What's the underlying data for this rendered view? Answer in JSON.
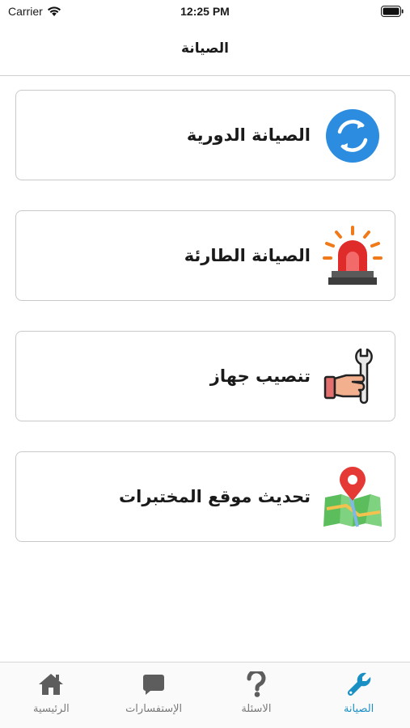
{
  "status_bar": {
    "carrier": "Carrier",
    "time": "12:25 PM"
  },
  "nav": {
    "title": "الصيانة"
  },
  "cards": [
    {
      "label": "الصيانة الدورية",
      "icon": "refresh-cycle-icon"
    },
    {
      "label": "الصيانة الطارئة",
      "icon": "siren-icon"
    },
    {
      "label": "تنصيب جهاز",
      "icon": "wrench-hand-icon"
    },
    {
      "label": "تحديث موقع المختبرات",
      "icon": "map-pin-icon"
    }
  ],
  "tabs": [
    {
      "label": "الرئيسية",
      "icon": "home-icon"
    },
    {
      "label": "الإستفسارات",
      "icon": "chat-icon"
    },
    {
      "label": "الاسئلة",
      "icon": "question-icon"
    },
    {
      "label": "الصيانة",
      "icon": "wrench-icon",
      "active": true
    }
  ],
  "colors": {
    "accent": "#1a8fc4",
    "inactive": "#5d5d5d",
    "cycle_blue": "#2b8ce0",
    "siren_red": "#e02b2b"
  }
}
